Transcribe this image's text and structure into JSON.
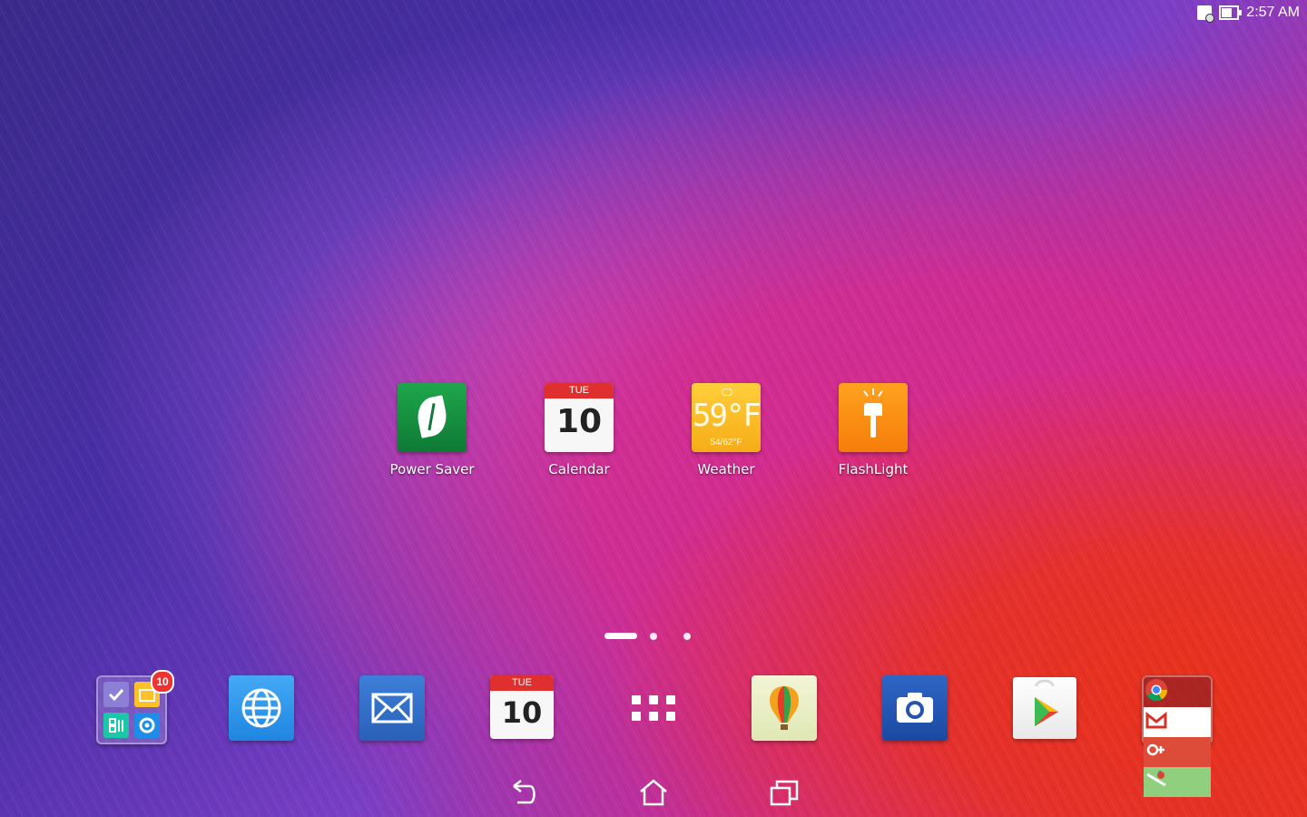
{
  "status_bar": {
    "time": "2:57 AM",
    "icons": [
      "sim-card-icon",
      "battery-icon"
    ]
  },
  "desktop_apps": [
    {
      "label": "Power Saver",
      "icon": "leaf-icon",
      "color": "#1a9844"
    },
    {
      "label": "Calendar",
      "icon": "calendar-icon",
      "weekday": "TUE",
      "day": "10"
    },
    {
      "label": "Weather",
      "icon": "weather-icon",
      "temp": "59°F",
      "range": "54/62°F"
    },
    {
      "label": "FlashLight",
      "icon": "flashlight-icon",
      "color": "#f58a10"
    }
  ],
  "pager": {
    "pages": 3,
    "current": 1
  },
  "dock": {
    "folder_badge": "10",
    "calendar": {
      "weekday": "TUE",
      "day": "10"
    },
    "items": [
      "asus-folder",
      "browser-icon",
      "mail-icon",
      "calendar-icon",
      "all-apps-icon",
      "balloon-app-icon",
      "camera-icon",
      "play-store-icon",
      "google-folder"
    ]
  },
  "nav_bar": [
    "back-icon",
    "home-icon",
    "recent-apps-icon"
  ]
}
